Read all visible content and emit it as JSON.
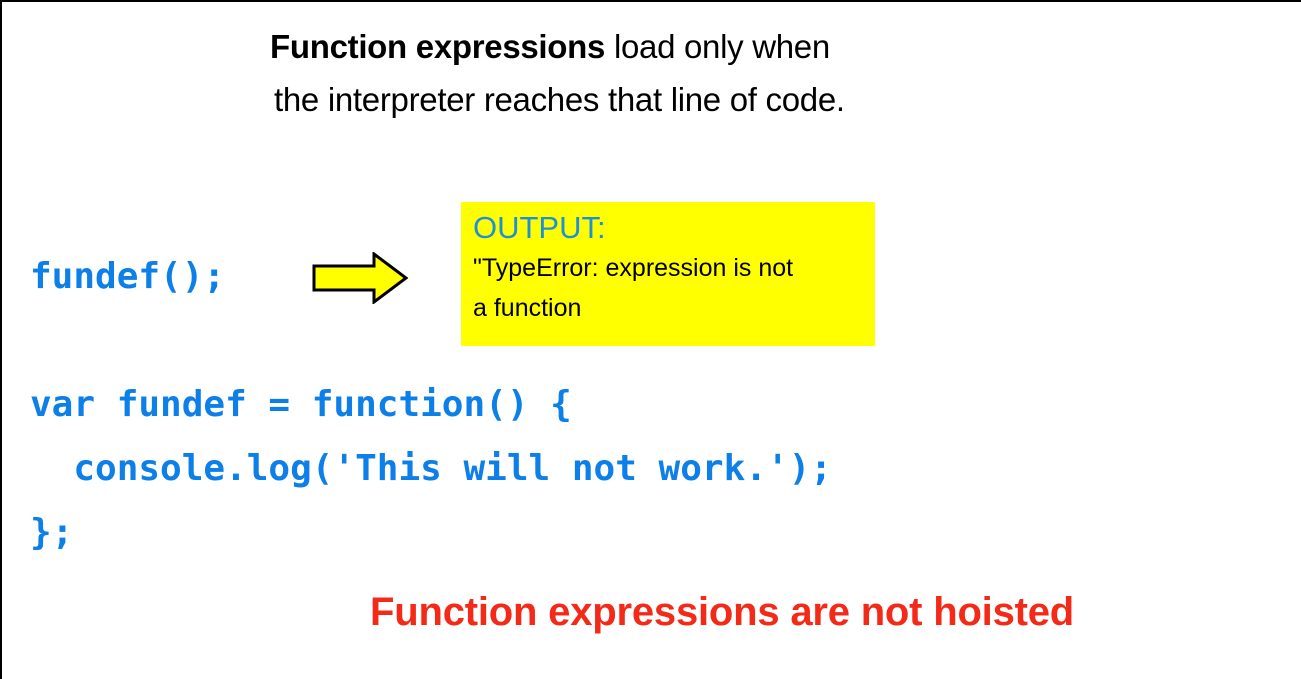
{
  "slide": {
    "background_color": "#ffffff",
    "border_color": "#000000"
  },
  "heading": {
    "emphasis": "Function expressions",
    "rest": " load only when",
    "line2": "the interpreter reaches that line of code."
  },
  "code_block": {
    "color": "#0d7fe8",
    "lines": [
      "fundef();",
      "var fundef = function() {",
      "  console.log('This will not work.');",
      "};"
    ]
  },
  "arrow": {
    "name": "right-block-arrow",
    "fill": "#ffff00",
    "stroke": "#000000",
    "direction": "right"
  },
  "output_box": {
    "background": "#ffff00",
    "label": "OUTPUT:",
    "label_color": "#1e90d8",
    "text": "\"TypeError: expression is not\na function",
    "text_color": "#000000"
  },
  "takeaway": {
    "text": "Function expressions are not hoisted",
    "color": "#f42a18"
  }
}
